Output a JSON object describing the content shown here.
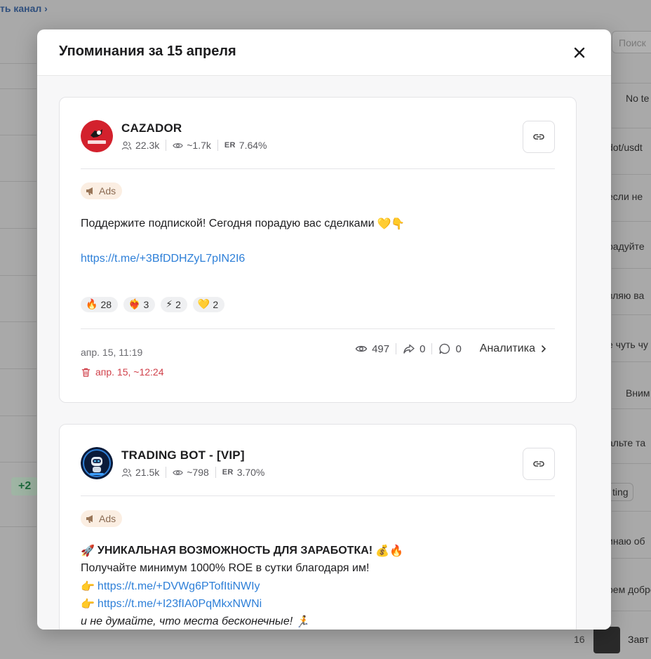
{
  "background": {
    "top_link": "ть канал ›",
    "search_placeholder": "Поиск",
    "right_snippets": [
      "No te",
      "dot/usdt",
      "если не",
      "радуйте",
      "вляю ва",
      "е чуть чу",
      "Вним",
      "альте та",
      "рем добро",
      "инаю об",
      "Завт"
    ],
    "green_badge": "+2",
    "tag": "ting",
    "row_number": "16"
  },
  "modal": {
    "title": "Упоминания за 15 апреля",
    "close_icon": "close-icon"
  },
  "posts": [
    {
      "channel": {
        "name": "CAZADOR",
        "avatar_text": "CAZADOR",
        "subscribers": "22.3k",
        "views": "~1.7k",
        "er_label": "ER",
        "er": "7.64%"
      },
      "badge": "Ads",
      "text_line": "Поддержите подпиской! Сегодня порадую вас сделками",
      "text_emoji": "💛👇",
      "link": "https://t.me/+3BfDDHZyL7pIN2I6",
      "reactions": [
        {
          "emoji": "🔥",
          "count": "28"
        },
        {
          "emoji": "❤️‍🔥",
          "count": "3"
        },
        {
          "emoji": "⚡",
          "count": "2"
        },
        {
          "emoji": "💛",
          "count": "2"
        }
      ],
      "date": "апр. 15, 11:19",
      "deleted_date": "апр. 15, ~12:24",
      "metrics": {
        "views": "497",
        "shares": "0",
        "comments": "0"
      },
      "analytics_label": "Аналитика"
    },
    {
      "channel": {
        "name": "TRADING BOT - [VIP]",
        "subscribers": "21.5k",
        "views": "~798",
        "er_label": "ER",
        "er": "3.70%"
      },
      "badge": "Ads",
      "headline_emoji": "🚀",
      "headline": "УНИКАЛЬНАЯ ВОЗМОЖНОСТЬ ДЛЯ ЗАРАБОТКА!",
      "headline_tail_emoji": "💰🔥",
      "line2": "Получайте минимум 1000% ROE в сутки благодаря им!",
      "link1_emoji": "👉",
      "link1": "https://t.me/+DVWg6PTofItiNWIy",
      "link2_emoji": "👉",
      "link2": "https://t.me/+I23fIA0PqMkxNWNi",
      "line5": "и не думайте, что места бесконечные!",
      "line5_emoji": "🏃"
    }
  ],
  "colors": {
    "accent_link": "#2d7fd8",
    "deleted_red": "#d0404a",
    "ads_bg": "#fbeee2"
  }
}
